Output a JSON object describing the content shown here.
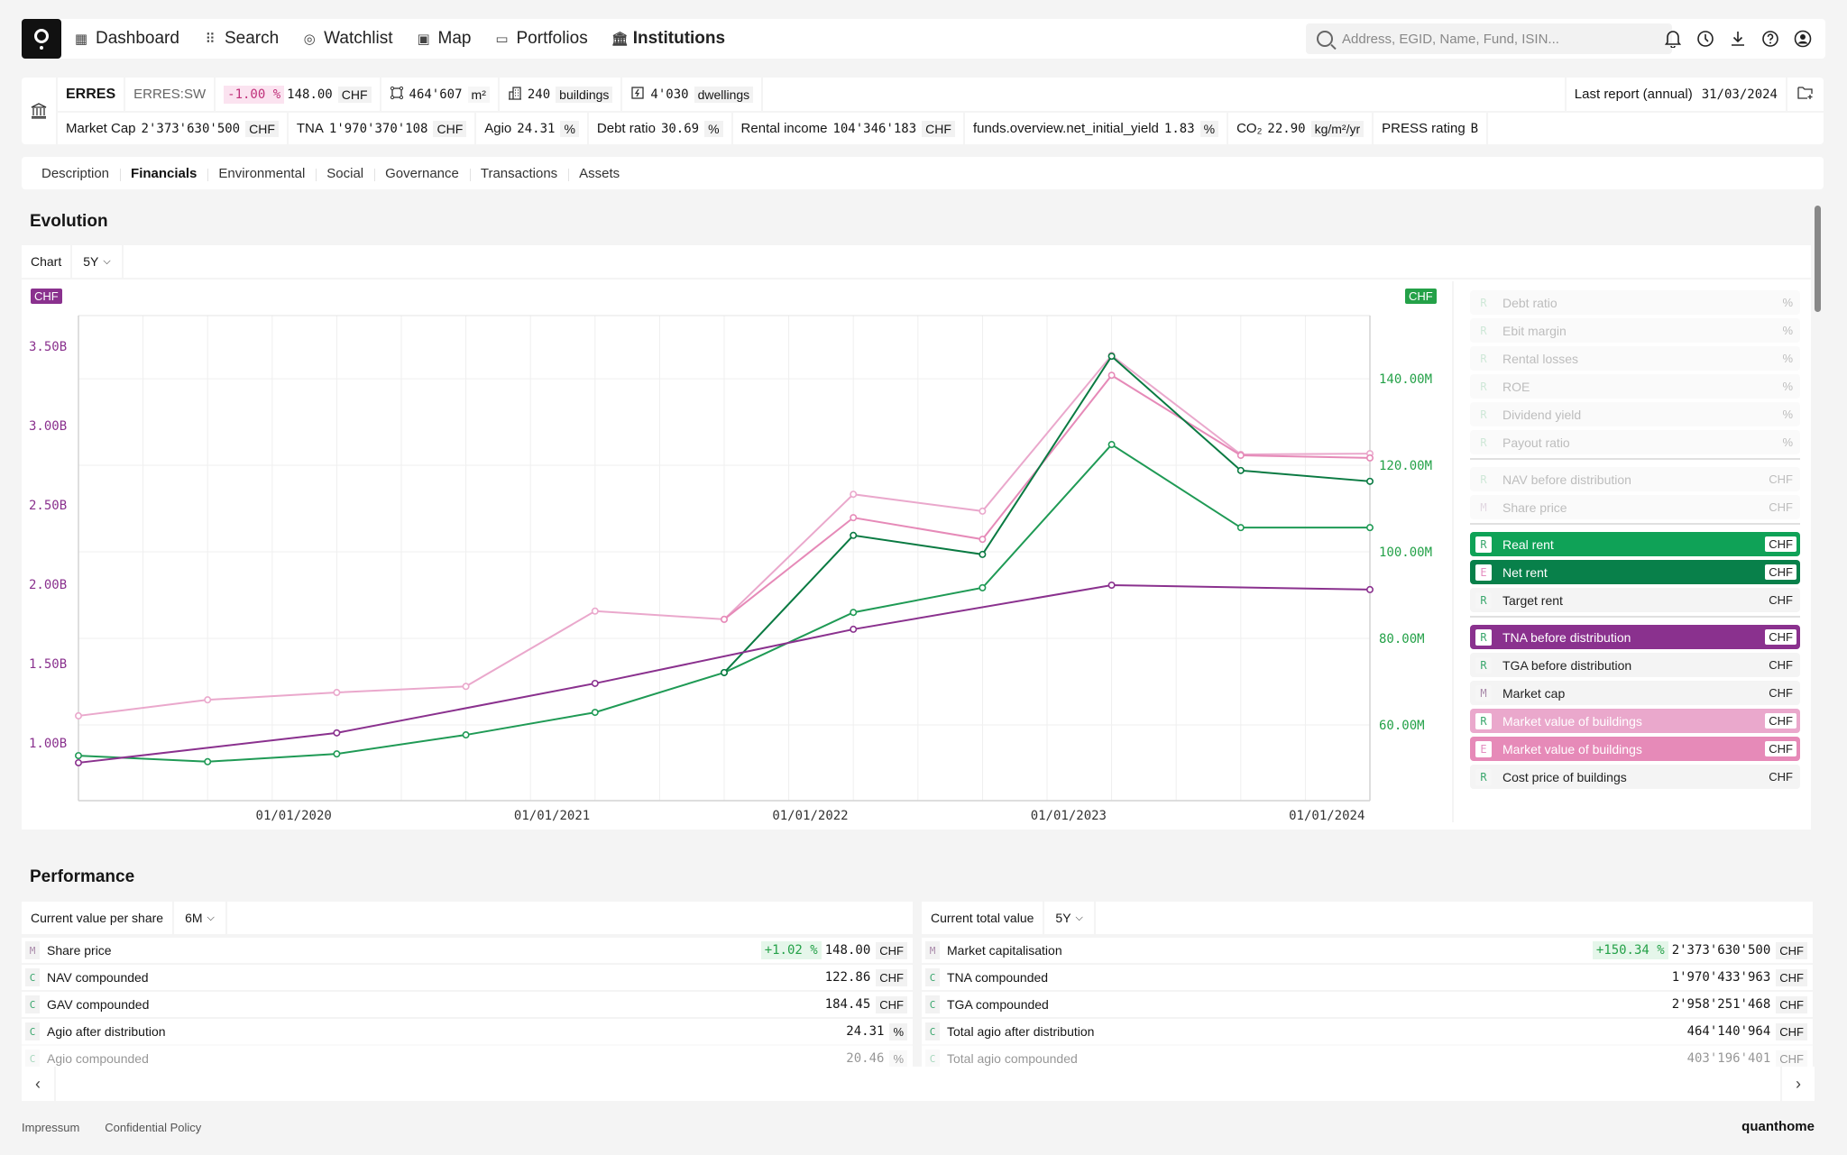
{
  "nav": {
    "items": [
      {
        "label": "Dashboard",
        "icon": "dashboard-icon",
        "glyph": "▦"
      },
      {
        "label": "Search",
        "icon": "grid-icon",
        "glyph": "⠿"
      },
      {
        "label": "Watchlist",
        "icon": "watchlist-icon",
        "glyph": "◎"
      },
      {
        "label": "Map",
        "icon": "map-icon",
        "glyph": "▣"
      },
      {
        "label": "Portfolios",
        "icon": "folder-icon",
        "glyph": "▭"
      },
      {
        "label": "Institutions",
        "icon": "institution-icon",
        "glyph": "🏛"
      }
    ],
    "active": "Institutions",
    "search_placeholder": "Address, EGID, Name, Fund, ISIN..."
  },
  "fund": {
    "name": "ERRES",
    "ticker": "ERRES:SW",
    "change": "-1.00 %",
    "price": "148.00",
    "price_unit": "CHF",
    "area": "464'607",
    "area_unit": "m²",
    "buildings": "240",
    "buildings_unit": "buildings",
    "dwellings": "4'030",
    "dwellings_unit": "dwellings",
    "last_report_label": "Last report (annual)",
    "last_report_date": "31/03/2024",
    "metrics": [
      {
        "label": "Market Cap",
        "value": "2'373'630'500",
        "unit": "CHF"
      },
      {
        "label": "TNA",
        "value": "1'970'370'108",
        "unit": "CHF"
      },
      {
        "label": "Agio",
        "value": "24.31",
        "unit": "%"
      },
      {
        "label": "Debt ratio",
        "value": "30.69",
        "unit": "%"
      },
      {
        "label": "Rental income",
        "value": "104'346'183",
        "unit": "CHF"
      },
      {
        "label": "funds.overview.net_initial_yield",
        "value": "1.83",
        "unit": "%"
      },
      {
        "label": "CO₂",
        "value": "22.90",
        "unit": "kg/m²/yr"
      },
      {
        "label": "PRESS rating",
        "value": "B",
        "unit": ""
      }
    ]
  },
  "tabs": [
    "Description",
    "Financials",
    "Environmental",
    "Social",
    "Governance",
    "Transactions",
    "Assets"
  ],
  "active_tab": "Financials",
  "evolution": {
    "title": "Evolution",
    "toolbar_label": "Chart",
    "period": "5Y",
    "left_unit": "CHF",
    "right_unit": "CHF",
    "legend": [
      {
        "badge": "R",
        "label": "Debt ratio",
        "unit": "%",
        "state": "faded"
      },
      {
        "badge": "R",
        "label": "Ebit margin",
        "unit": "%",
        "state": "faded"
      },
      {
        "badge": "R",
        "label": "Rental losses",
        "unit": "%",
        "state": "faded"
      },
      {
        "badge": "R",
        "label": "ROE",
        "unit": "%",
        "state": "faded"
      },
      {
        "badge": "R",
        "label": "Dividend yield",
        "unit": "%",
        "state": "faded"
      },
      {
        "badge": "R",
        "label": "Payout ratio",
        "unit": "%",
        "state": "faded",
        "sep_after": true
      },
      {
        "badge": "R",
        "label": "NAV before distribution",
        "unit": "CHF",
        "state": "faded"
      },
      {
        "badge": "M",
        "label": "Share price",
        "unit": "CHF",
        "state": "faded",
        "sep_after": true
      },
      {
        "badge": "R",
        "label": "Real rent",
        "unit": "CHF",
        "state": "on",
        "color": "#0fa257"
      },
      {
        "badge": "E",
        "label": "Net rent",
        "unit": "CHF",
        "state": "on",
        "color": "#08804a"
      },
      {
        "badge": "R",
        "label": "Target rent",
        "unit": "CHF",
        "state": "off",
        "sep_after": true
      },
      {
        "badge": "R",
        "label": "TNA before distribution",
        "unit": "CHF",
        "state": "on",
        "color": "#8a318e"
      },
      {
        "badge": "R",
        "label": "TGA before distribution",
        "unit": "CHF",
        "state": "off"
      },
      {
        "badge": "M",
        "label": "Market cap",
        "unit": "CHF",
        "state": "off"
      },
      {
        "badge": "R",
        "label": "Market value of buildings",
        "unit": "CHF",
        "state": "on",
        "color": "#eaa8cc"
      },
      {
        "badge": "E",
        "label": "Market value of buildings",
        "unit": "CHF",
        "state": "on",
        "color": "#e68ab8"
      },
      {
        "badge": "R",
        "label": "Cost price of buildings",
        "unit": "CHF",
        "state": "off"
      }
    ]
  },
  "chart_data": {
    "type": "line",
    "title": "Evolution",
    "x": [
      "31/03/2019",
      "30/09/2019",
      "31/03/2020",
      "30/09/2020",
      "31/03/2021",
      "30/09/2021",
      "31/03/2022",
      "30/09/2022",
      "31/03/2023",
      "30/09/2023",
      "31/03/2024"
    ],
    "x_ticks": [
      "01/01/2020",
      "01/01/2021",
      "01/01/2022",
      "01/01/2023",
      "01/01/2024"
    ],
    "y_left": {
      "unit": "CHF",
      "ticks": [
        "1.00B",
        "1.50B",
        "2.00B",
        "2.50B",
        "3.00B",
        "3.50B"
      ],
      "tick_values": [
        1.0,
        1.5,
        2.0,
        2.5,
        3.0,
        3.5
      ],
      "range": [
        0.636,
        3.693
      ],
      "scale": "billions",
      "color": "#8a318e"
    },
    "y_right": {
      "unit": "CHF",
      "ticks": [
        "60.00M",
        "80.00M",
        "100.00M",
        "120.00M",
        "140.00M"
      ],
      "tick_values": [
        60,
        80,
        100,
        120,
        140
      ],
      "range": [
        42.5,
        154.6
      ],
      "scale": "millions",
      "color": "#24a148"
    },
    "grid": true,
    "legend": "right",
    "series": [
      {
        "name": "Market value of buildings (R)",
        "axis": "right",
        "color": "#eaa8cc",
        "values": [
          62.1,
          65.8,
          67.5,
          68.9,
          86.3,
          84.4,
          113.3,
          109.4,
          145.4,
          122.5,
          122.7
        ]
      },
      {
        "name": "Market value of buildings (E)",
        "axis": "right",
        "color": "#e68ab8",
        "values": [
          null,
          null,
          null,
          null,
          null,
          84.4,
          107.9,
          102.9,
          140.8,
          122.3,
          121.7
        ]
      },
      {
        "name": "Real rent",
        "axis": "right",
        "color": "#1f9a55",
        "values": [
          52.9,
          51.5,
          53.3,
          57.7,
          62.9,
          72.1,
          86.0,
          91.7,
          124.8,
          105.6,
          105.6
        ]
      },
      {
        "name": "Net rent",
        "axis": "right",
        "color": "#0a7a42",
        "values": [
          null,
          null,
          null,
          null,
          null,
          72.1,
          103.8,
          99.4,
          145.2,
          118.8,
          116.3
        ]
      },
      {
        "name": "TNA before distribution",
        "axis": "left",
        "color": "#8a318e",
        "values": [
          0.875,
          null,
          1.063,
          null,
          1.375,
          null,
          1.716,
          null,
          1.994,
          null,
          1.966
        ]
      }
    ]
  },
  "performance": {
    "title": "Performance",
    "left": {
      "label": "Current value per share",
      "period": "6M",
      "rows": [
        {
          "badge": "M",
          "name": "Share price",
          "delta": "+1.02 %",
          "value": "148.00",
          "unit": "CHF"
        },
        {
          "badge": "C",
          "name": "NAV compounded",
          "delta": "",
          "value": "122.86",
          "unit": "CHF"
        },
        {
          "badge": "C",
          "name": "GAV compounded",
          "delta": "",
          "value": "184.45",
          "unit": "CHF"
        },
        {
          "badge": "C",
          "name": "Agio after distribution",
          "delta": "",
          "value": "24.31",
          "unit": "%"
        },
        {
          "badge": "C",
          "name": "Agio compounded",
          "delta": "",
          "value": "20.46",
          "unit": "%"
        }
      ]
    },
    "right": {
      "label": "Current total value",
      "period": "5Y",
      "rows": [
        {
          "badge": "M",
          "name": "Market capitalisation",
          "delta": "+150.34 %",
          "value": "2'373'630'500",
          "unit": "CHF"
        },
        {
          "badge": "C",
          "name": "TNA compounded",
          "delta": "",
          "value": "1'970'433'963",
          "unit": "CHF"
        },
        {
          "badge": "C",
          "name": "TGA compounded",
          "delta": "",
          "value": "2'958'251'468",
          "unit": "CHF"
        },
        {
          "badge": "C",
          "name": "Total agio after distribution",
          "delta": "",
          "value": "464'140'964",
          "unit": "CHF"
        },
        {
          "badge": "C",
          "name": "Total agio compounded",
          "delta": "",
          "value": "403'196'401",
          "unit": "CHF"
        }
      ]
    },
    "prev_label": "‹",
    "next_label": "›"
  },
  "footer": {
    "links": [
      "Impressum",
      "Confidential Policy"
    ],
    "brand": "quanthome"
  }
}
